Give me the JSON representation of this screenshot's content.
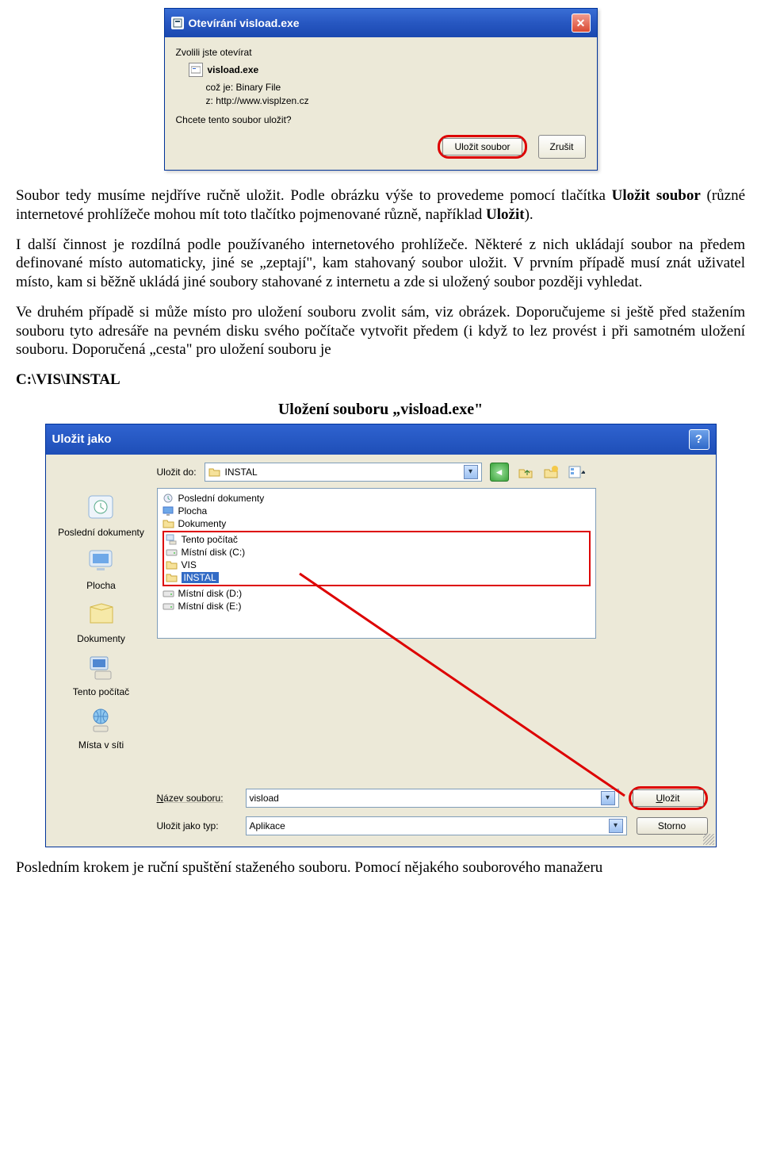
{
  "dialog1": {
    "title": "Otevírání visload.exe",
    "intro": "Zvolili jste otevírat",
    "filename": "visload.exe",
    "line_type_lbl": "což je:",
    "line_type_val": "Binary File",
    "line_from_lbl": "z:",
    "line_from_val": "http://www.visplzen.cz",
    "question": "Chcete tento soubor uložit?",
    "btn_save": "Uložit soubor",
    "btn_cancel": "Zrušit"
  },
  "para1_a": "Soubor tedy musíme nejdříve ručně uložit. Podle obrázku výše to provedeme pomocí tlačítka ",
  "para1_b": "Uložit soubor",
  "para1_c": " (různé internetové prohlížeče mohou mít toto tlačítko pojmenované různě, například ",
  "para1_d": "Uložit",
  "para1_e": ").",
  "para2": "I další činnost je rozdílná podle používaného internetového prohlížeče. Některé z nich ukládají soubor na předem definované místo automaticky, jiné se „zeptají\", kam stahovaný soubor uložit. V prvním případě musí znát uživatel místo, kam si běžně ukládá jiné soubory stahované z internetu a zde si uložený soubor později vyhledat.",
  "para3": "Ve druhém případě si může místo pro uložení souboru zvolit sám, viz obrázek. Doporučujeme si ještě před stažením souboru tyto adresáře na pevném disku svého počítače vytvořit předem (i když to lez provést i při samotném uložení souboru. Doporučená „cesta\" pro uložení souboru je",
  "path": "C:\\VIS\\INSTAL",
  "section_title": "Uložení souboru „visload.exe\"",
  "dialog2": {
    "title": "Uložit jako",
    "savein_lbl": "Uložit do:",
    "savein_val": "INSTAL",
    "sidebar": [
      "Poslední dokumenty",
      "Plocha",
      "Dokumenty",
      "Tento počítač",
      "Místa v síti"
    ],
    "tree": {
      "recent": "Poslední dokumenty",
      "desktop": "Plocha",
      "docs": "Dokumenty",
      "mypc": "Tento počítač",
      "c": "Místní disk (C:)",
      "vis": "VIS",
      "instal": "INSTAL",
      "d": "Místní disk (D:)",
      "e": "Místní disk (E:)"
    },
    "fname_lbl": "Název souboru:",
    "fname_val": "visload",
    "ftype_lbl": "Uložit jako typ:",
    "ftype_val": "Aplikace",
    "btn_save": "Uložit",
    "btn_cancel": "Storno"
  },
  "para4": "Posledním krokem je ruční spuštění staženého souboru. Pomocí nějakého souborového manažeru"
}
